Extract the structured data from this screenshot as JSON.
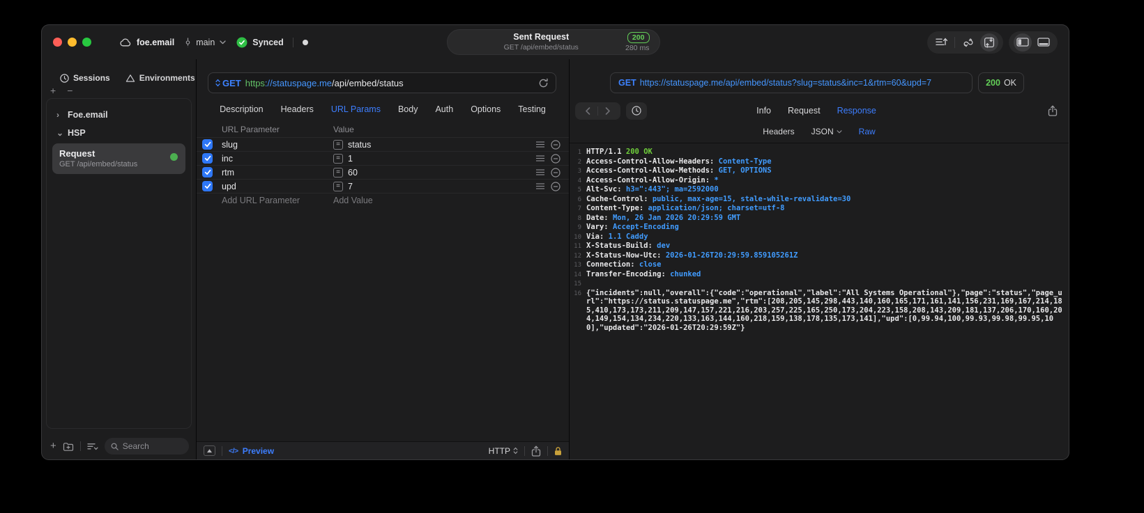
{
  "titlebar": {
    "project": "foe.email",
    "branch": "main",
    "sync": "Synced",
    "request_summary": {
      "title": "Sent Request",
      "subtitle": "GET /api/embed/status",
      "status": "200",
      "duration": "280 ms"
    }
  },
  "sidebar": {
    "tabs": {
      "sessions": "Sessions",
      "environments": "Environments"
    },
    "tree": {
      "group1": "Foe.email",
      "group2": "HSP"
    },
    "request_item": {
      "title": "Request",
      "subtitle": "GET /api/embed/status"
    },
    "search_placeholder": "Search"
  },
  "request": {
    "method": "GET",
    "url_scheme": "https",
    "url_host": "://statuspage.me",
    "url_path": "/api/embed/status",
    "tabs": [
      "Description",
      "Headers",
      "URL Params",
      "Body",
      "Auth",
      "Options",
      "Testing"
    ],
    "active_tab": "URL Params",
    "params": {
      "col_name": "URL Parameter",
      "col_value": "Value",
      "rows": [
        {
          "name": "slug",
          "value": "status",
          "enabled": true
        },
        {
          "name": "inc",
          "value": "1",
          "enabled": true
        },
        {
          "name": "rtm",
          "value": "60",
          "enabled": true
        },
        {
          "name": "upd",
          "value": "7",
          "enabled": true
        }
      ],
      "add_name": "Add URL Parameter",
      "add_value": "Add Value"
    },
    "footer": {
      "preview": "Preview",
      "protocol": "HTTP"
    }
  },
  "response": {
    "method": "GET",
    "url": "https://statuspage.me/api/embed/status?slug=status&inc=1&rtm=60&upd=7",
    "status_code": "200",
    "status_text": "OK",
    "tabs": [
      "Info",
      "Request",
      "Response"
    ],
    "active_tab": "Response",
    "subtabs": {
      "headers": "Headers",
      "json": "JSON",
      "raw": "Raw"
    },
    "active_subtab": "Raw",
    "status_line": {
      "protocol": "HTTP/1.1",
      "status": "200 OK"
    },
    "headers": [
      {
        "name": "Access-Control-Allow-Headers",
        "value": "Content-Type"
      },
      {
        "name": "Access-Control-Allow-Methods",
        "value": "GET, OPTIONS"
      },
      {
        "name": "Access-Control-Allow-Origin",
        "value": "*"
      },
      {
        "name": "Alt-Svc",
        "value": "h3=\":443\"; ma=2592000"
      },
      {
        "name": "Cache-Control",
        "value": "public, max-age=15, stale-while-revalidate=30"
      },
      {
        "name": "Content-Type",
        "value": "application/json; charset=utf-8"
      },
      {
        "name": "Date",
        "value": "Mon, 26 Jan 2026 20:29:59 GMT"
      },
      {
        "name": "Vary",
        "value": "Accept-Encoding"
      },
      {
        "name": "Via",
        "value": "1.1 Caddy"
      },
      {
        "name": "X-Status-Build",
        "value": "dev"
      },
      {
        "name": "X-Status-Now-Utc",
        "value": "2026-01-26T20:29:59.859105261Z"
      },
      {
        "name": "Connection",
        "value": "close"
      },
      {
        "name": "Transfer-Encoding",
        "value": "chunked"
      }
    ],
    "body": "{\"incidents\":null,\"overall\":{\"code\":\"operational\",\"label\":\"All Systems Operational\"},\"page\":\"status\",\"page_url\":\"https://status.statuspage.me\",\"rtm\":[208,205,145,298,443,140,160,165,171,161,141,156,231,169,167,214,185,410,173,173,211,209,147,157,221,216,203,257,225,165,250,173,204,223,158,208,143,209,181,137,206,170,160,204,149,154,134,234,220,133,163,144,160,218,159,138,178,135,173,141],\"upd\":[0,99.94,100,99.93,99.98,99.95,100],\"updated\":\"2026-01-26T20:29:59Z\"}"
  },
  "glyphs": {
    "plus": "+",
    "minus": "−",
    "equals": "=",
    "code_tag": "</>",
    "colon_space": ": ",
    "space": " ",
    "chevron_right": "›",
    "chevron_down": "⌄"
  },
  "colors": {
    "accent_blue": "#3d7eff",
    "link_blue": "#4596ff",
    "success_green": "#2fbf45",
    "status_green": "#63cf58",
    "code_green": "#70cf3c",
    "checkbox_blue": "#2e77f6",
    "lock_gold": "#c9a13b",
    "traffic_red": "#ff5f57",
    "traffic_yellow": "#febc2e",
    "traffic_green": "#28c840"
  }
}
